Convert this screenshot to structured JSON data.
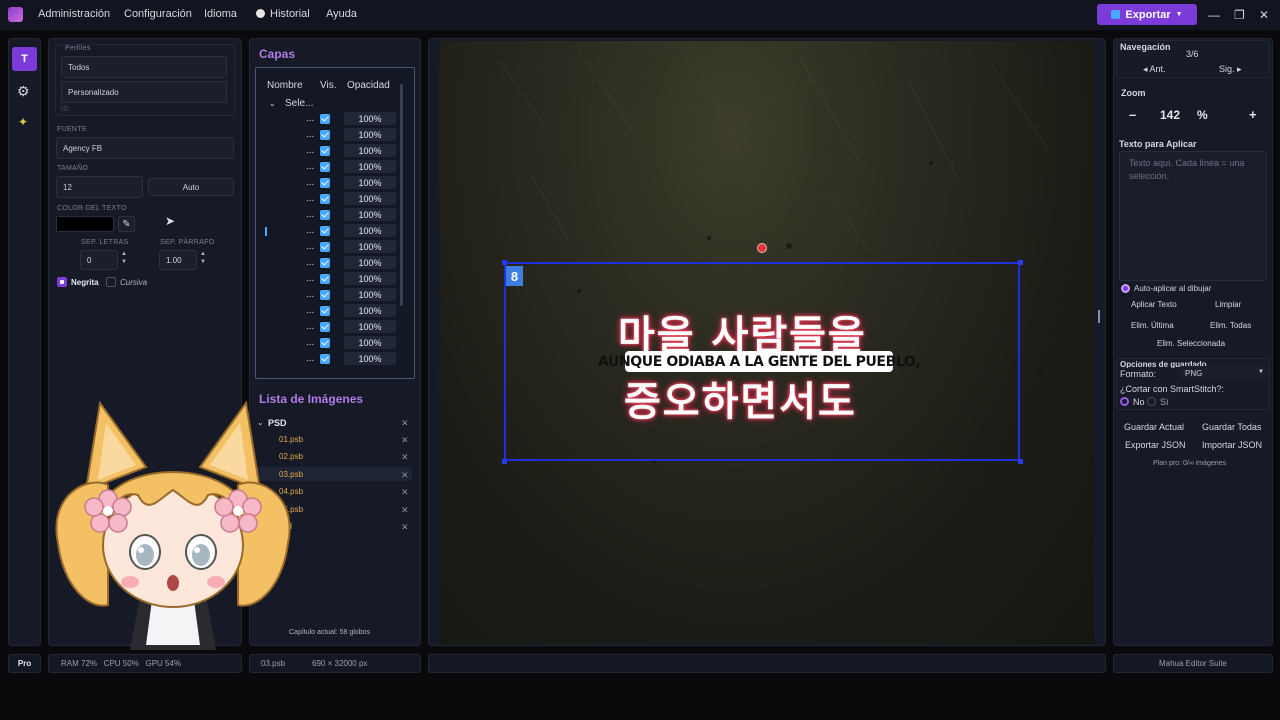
{
  "menu": {
    "items": [
      "Administración",
      "Configuración",
      "Idioma",
      "Historial",
      "Ayuda"
    ],
    "export_label": "Exportar"
  },
  "window": {
    "minimize": "—",
    "maximize": "❐",
    "close": "✕"
  },
  "toolbar": {
    "active_tool": "T"
  },
  "props": {
    "perfiles_label": "Perfiles",
    "perfil_todos": "Todos",
    "perfil_personalizado": "Personalizado",
    "id_label": "ID: -",
    "fuente_label": "FUENTE",
    "fuente_value": "Agency FB",
    "tamano_label": "TAMAÑO",
    "tamano_value": "12",
    "auto_label": "Auto",
    "color_label": "COLOR DEL TEXTO",
    "color_value": "#000000",
    "sep_letras_label": "SEP. LETRAS",
    "sep_letras_value": "0",
    "sep_parrafo_label": "SEP. PÁRRAFO",
    "sep_parrafo_value": "1.00",
    "negrita_label": "Negrita",
    "negrita_checked": true,
    "cursiva_label": "Cursiva",
    "cursiva_checked": false
  },
  "layers": {
    "title": "Capas",
    "col_nombre": "Nombre",
    "col_vis": "Vis.",
    "col_opacidad": "Opacidad",
    "group_label": "Sele...",
    "rows": [
      {
        "name": "...",
        "opacity": "100%"
      },
      {
        "name": "...",
        "opacity": "100%"
      },
      {
        "name": "...",
        "opacity": "100%"
      },
      {
        "name": "...",
        "opacity": "100%"
      },
      {
        "name": "...",
        "opacity": "100%"
      },
      {
        "name": "...",
        "opacity": "100%"
      },
      {
        "name": "...",
        "opacity": "100%"
      },
      {
        "name": "...",
        "opacity": "100%"
      },
      {
        "name": "...",
        "opacity": "100%"
      },
      {
        "name": "...",
        "opacity": "100%"
      },
      {
        "name": "...",
        "opacity": "100%"
      },
      {
        "name": "...",
        "opacity": "100%"
      },
      {
        "name": "...",
        "opacity": "100%"
      },
      {
        "name": "...",
        "opacity": "100%"
      },
      {
        "name": "...",
        "opacity": "100%"
      },
      {
        "name": "...",
        "opacity": "100%"
      }
    ]
  },
  "images": {
    "title": "Lista de Imágenes",
    "folder": "PSD",
    "files": [
      "01.psb",
      "02.psb",
      "03.psb",
      "04.psb",
      "05.psb",
      "psd"
    ],
    "selected_file": "03.psb",
    "chapter_status": "Capítulo actual: 58 globos"
  },
  "canvas": {
    "bubble_number": "8",
    "korean_line1": "마을 사람들을",
    "korean_line2": "증오하면서도",
    "spanish_text": "AUNQUE ODIABA A LA GENTE DEL PUEBLO,"
  },
  "right": {
    "nav_title": "Navegación",
    "nav_page": "3/6",
    "prev_label": "◂ Ant.",
    "next_label": "Sig. ▸",
    "zoom_title": "Zoom",
    "zoom_minus": "–",
    "zoom_value": "142",
    "zoom_unit": "%",
    "zoom_plus": "+",
    "text_title": "Texto para Aplicar",
    "text_placeholder": "Texto aquí. Cada línea = una selección.",
    "auto_apply_label": "Auto-aplicar al dibujar",
    "auto_apply_checked": true,
    "apply_text": "Aplicar Texto",
    "clear": "Limpiar",
    "del_last": "Elim. Última",
    "del_all": "Elim. Todas",
    "del_selected": "Elim. Seleccionada",
    "save_options_title": "Opciones de guardado",
    "format_label": "Formato:",
    "format_value": "PNG",
    "smartstitch_label": "¿Cortar con SmartStitch?:",
    "opt_no": "No",
    "opt_si": "Sí",
    "save_current": "Guardar Actual",
    "save_all": "Guardar Todas",
    "export_json": "Exportar JSON",
    "import_json": "Importar JSON",
    "plan_label": "Plan pro: 0/∞ imágenes"
  },
  "status": {
    "plan_badge": "Pro",
    "resources": "RAM 72%   CPU 50%   GPU 54%",
    "file": "03.psb",
    "dimensions": "690 × 32000 px",
    "app_name": "Mahua Editor Suite"
  },
  "colors": {
    "accent": "#7c3ad8",
    "panel": "#161a26",
    "selection": "#1f2fd9",
    "file_text": "#e0a84e"
  }
}
